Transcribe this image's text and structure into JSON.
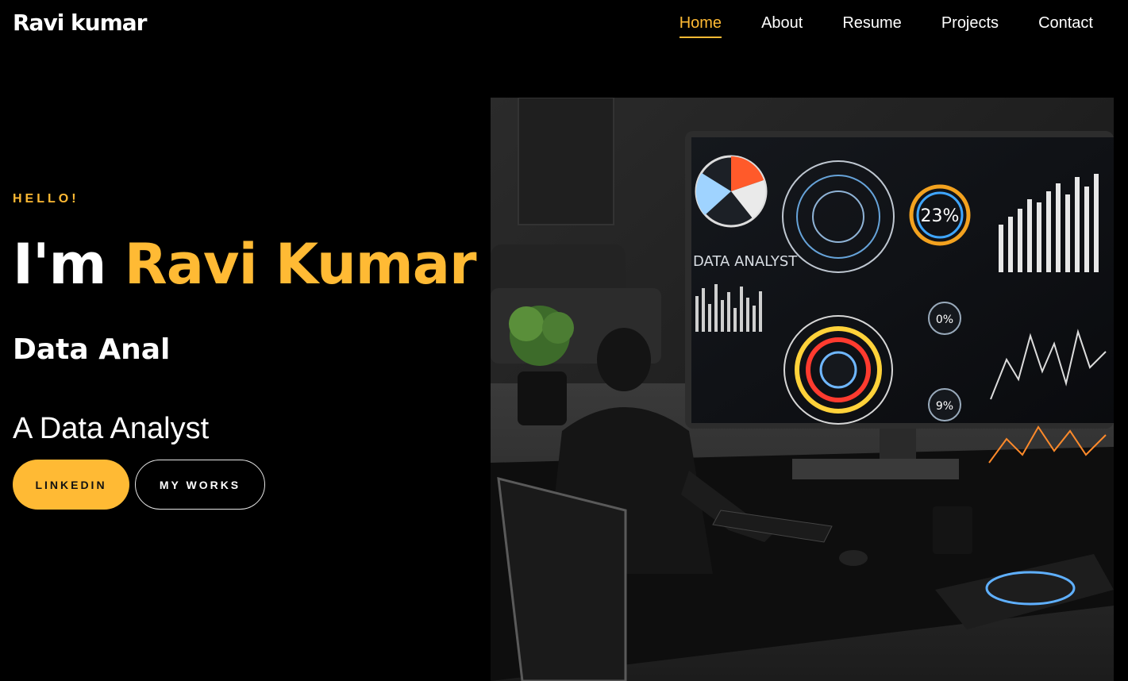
{
  "header": {
    "logo": "Ravi kumar",
    "nav": [
      {
        "label": "Home",
        "active": true
      },
      {
        "label": "About",
        "active": false
      },
      {
        "label": "Resume",
        "active": false
      },
      {
        "label": "Projects",
        "active": false
      },
      {
        "label": "Contact",
        "active": false
      }
    ]
  },
  "hero": {
    "greeting": "HELLO!",
    "intro": "I'm",
    "name": "Ravi Kumar",
    "typed_text": "Data Anal",
    "tagline": "A Data Analyst",
    "buttons": {
      "primary": "LINKEDIN",
      "secondary": "MY WORKS"
    },
    "image": {
      "screen_title": "DATA ANALYST",
      "gauge_value": "23%",
      "gauge_small_1": "0%",
      "gauge_small_2": "9%"
    }
  },
  "colors": {
    "accent": "#ffba34",
    "background": "#000000",
    "text": "#ffffff"
  }
}
